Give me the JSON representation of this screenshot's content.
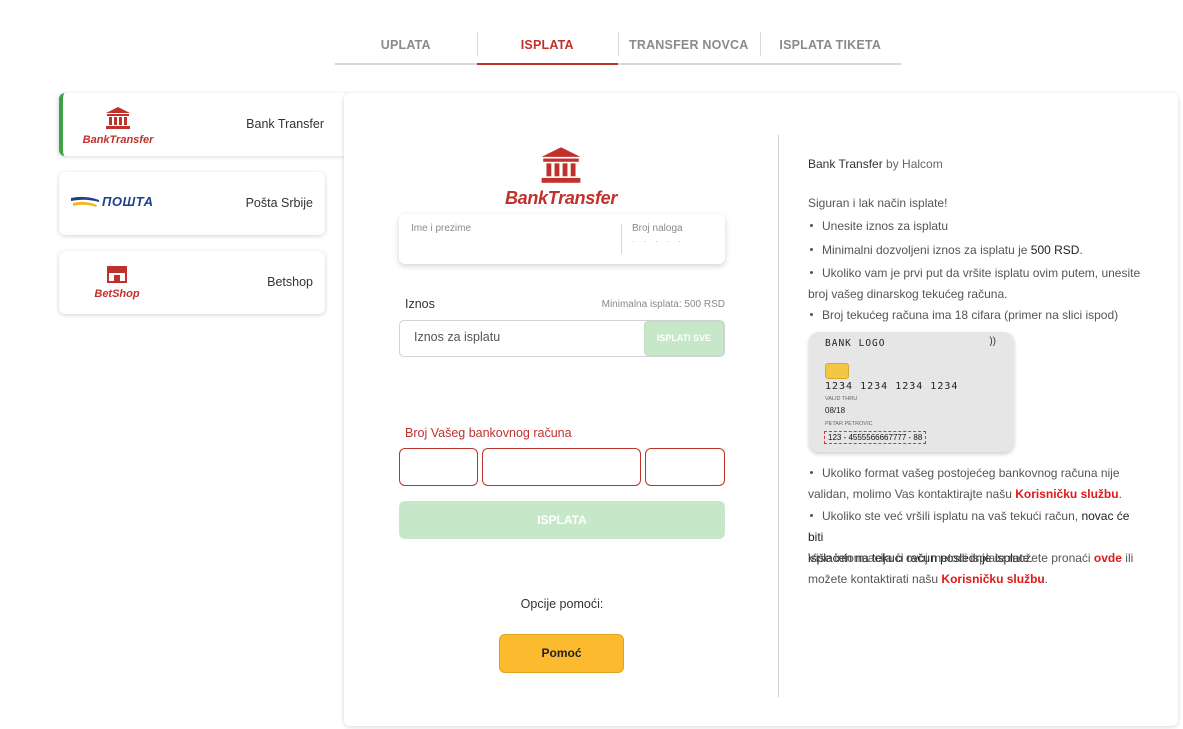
{
  "tabs": [
    {
      "label": "UPLATA",
      "active": false
    },
    {
      "label": "ISPLATA",
      "active": true
    },
    {
      "label": "TRANSFER NOVCA",
      "active": false
    },
    {
      "label": "ISPLATA TIKETA",
      "active": false
    }
  ],
  "methods": [
    {
      "label": "Bank Transfer",
      "logo_text": "BankTransfer",
      "active": true
    },
    {
      "label": "Pošta Srbije",
      "logo_text": "ПОШТА",
      "active": false
    },
    {
      "label": "Betshop",
      "logo_text": "BetShop",
      "active": false
    }
  ],
  "form": {
    "logo_text": "BankTransfer",
    "name_label": "Ime i prezime",
    "account_id_label": "Broj naloga",
    "amount_label": "Iznos",
    "min_label": "Minimalna isplata: 500 RSD",
    "amount_placeholder": "Iznos za isplatu",
    "pay_all_label": "ISPLATI SVE",
    "bank_account_label": "Broj Vašeg bankovnog računa",
    "submit_label": "ISPLATA",
    "help_title": "Opcije pomoći:",
    "help_button": "Pomoć"
  },
  "info": {
    "provider": "Bank Transfer",
    "provider_by": "by Halcom",
    "intro": "Siguran i lak način isplate!",
    "b1": "Unesite iznos za isplatu",
    "b2_pre": "Minimalni dozvoljeni iznos za isplatu je ",
    "b2_amount": "500 RSD",
    "b3_line1": "Ukoliko vam je prvi put da vršite isplatu ovim putem, unesite",
    "b3_line2": "broj vašeg dinarskog tekućeg računa.",
    "b4": "Broj tekućeg računa ima 18 cifara (primer na slici ispod)",
    "b5_line1": "Ukoliko format vašeg postojećeg bankovnog računa nije",
    "b5_line2_pre": "validan, molimo Vas kontaktirajte našu ",
    "b5_link": "Korisničku službu",
    "b6_line1_pre": "Ukoliko ste već vršili isplatu na vaš tekući račun, ",
    "b6_line1_strong": "novac će biti",
    "b6_line2_strong": "isplaćen na tekući račun poslednje isplate",
    "more_line1_pre": "Više informacija o ovoj metodi isplate možete pronaći ",
    "more_link1": "ovde",
    "more_line1_post": " ili",
    "more_line2_pre": "možete kontaktirati našu ",
    "more_link2": "Korisničku službu"
  },
  "card": {
    "bank": "BANK LOGO",
    "nfc": "))",
    "number": "1234 1234 1234 1234",
    "valid_thru": "VALID THRU",
    "expiry": "08/18",
    "holder": "PETAR PETROVIC",
    "account": "123 - 4555566667777 - 88"
  },
  "colors": {
    "accent": "#c0312b",
    "green": "#3aa346",
    "disabled_green": "#c6e8c8",
    "help": "#fcba2f",
    "link_red": "#e01818"
  }
}
